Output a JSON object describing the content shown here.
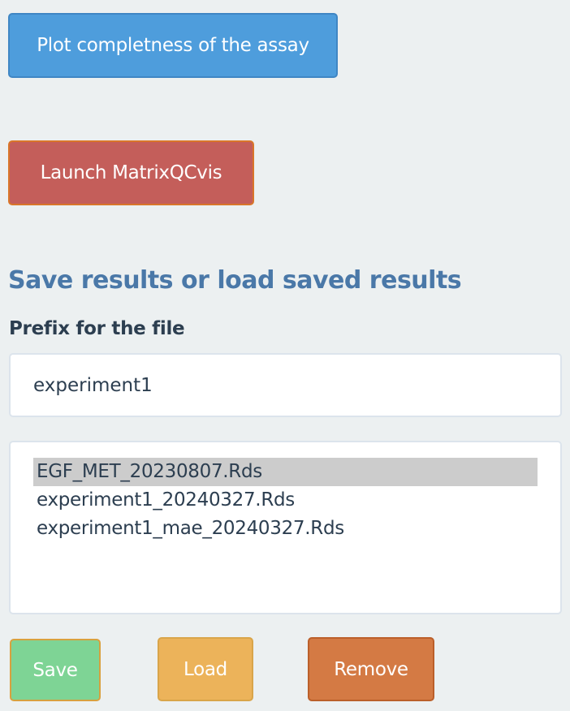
{
  "buttons": {
    "plot_completeness": "Plot completness of the assay",
    "launch_matrixqcvis": "Launch MatrixQCvis"
  },
  "save_section": {
    "title": "Save results or load saved results",
    "prefix_label": "Prefix for the file",
    "prefix_value": "experiment1",
    "files": [
      {
        "name": "EGF_MET_20230807.Rds",
        "selected": true
      },
      {
        "name": "experiment1_20240327.Rds",
        "selected": false
      },
      {
        "name": "experiment1_mae_20240327.Rds",
        "selected": false
      }
    ],
    "save_label": "Save",
    "load_label": "Load",
    "remove_label": "Remove"
  }
}
